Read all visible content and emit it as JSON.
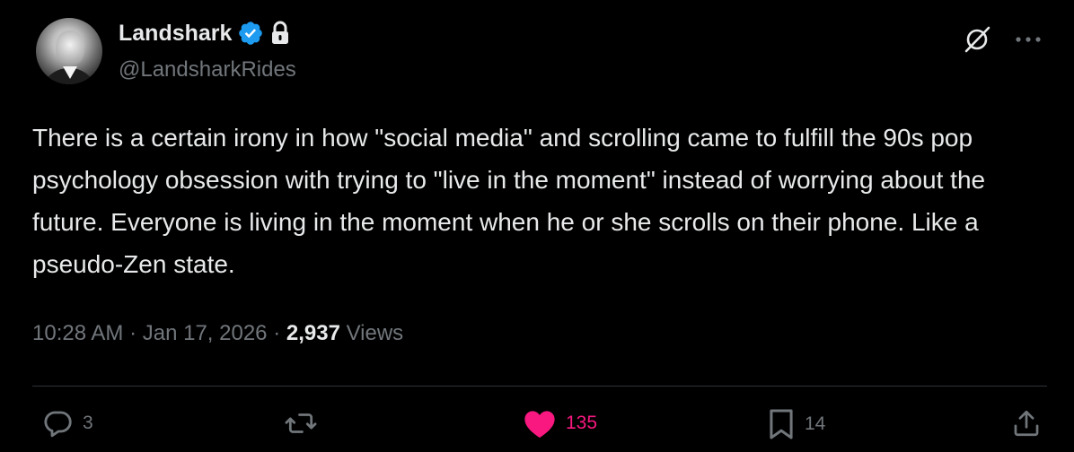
{
  "author": {
    "display_name": "Landshark",
    "handle": "@LandsharkRides",
    "verified": true,
    "protected": true,
    "verified_color": "#1d9bf0"
  },
  "tweet": {
    "text": "There is a certain irony in how \"social media\" and scrolling came to fulfill the 90s pop psychology obsession with trying to \"live in the moment\" instead of worrying about the future. Everyone is living in the moment when he or she scrolls on their phone. Like a pseudo-Zen state.",
    "time": "10:28 AM",
    "date": "Jan 17, 2026",
    "views_count": "2,937",
    "views_label": "Views"
  },
  "actions": {
    "replies": "3",
    "reposts": "",
    "likes": "135",
    "bookmarks": "14",
    "like_color": "#f91880"
  },
  "icons": [
    "grok-icon",
    "more-icon",
    "reply-icon",
    "retweet-icon",
    "like-icon",
    "bookmark-icon",
    "share-icon",
    "verified-badge-icon",
    "lock-icon"
  ]
}
